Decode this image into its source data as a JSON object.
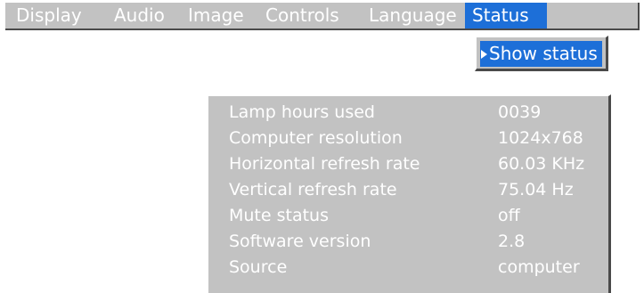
{
  "menu": {
    "items": [
      "Display",
      "Audio",
      "Image",
      "Controls",
      "Language",
      "Status"
    ],
    "active": "Status"
  },
  "submenu": {
    "items": [
      "Show status"
    ]
  },
  "status": {
    "rows": [
      {
        "label": "Lamp hours used",
        "value": "0039"
      },
      {
        "label": "Computer resolution",
        "value": "1024x768"
      },
      {
        "label": "Horizontal refresh rate",
        "value": "60.03 KHz"
      },
      {
        "label": "Vertical refresh rate",
        "value": "75.04 Hz"
      },
      {
        "label": "Mute status",
        "value": "off"
      },
      {
        "label": "Software version",
        "value": "2.8"
      },
      {
        "label": "Source",
        "value": "computer"
      }
    ]
  },
  "colors": {
    "menu_background": "#c2c2c2",
    "highlight": "#1d6fd8",
    "text": "#ffffff",
    "shadow": "#4a4a4a"
  },
  "icons": {
    "submenu_arrow": "right-triangle-icon"
  }
}
